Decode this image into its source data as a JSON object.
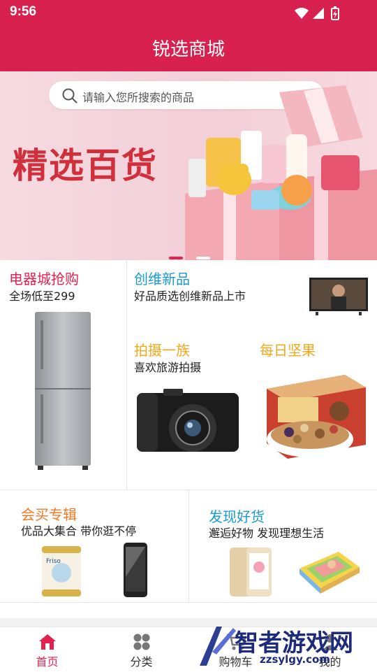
{
  "status": {
    "time": "9:56"
  },
  "header": {
    "title": "锐选商城"
  },
  "banner": {
    "search_placeholder": "请输入您所搜索的商品",
    "headline": "精选百货",
    "active_slide": 1,
    "slides_count": 2
  },
  "promos": [
    {
      "title": "电器城抢购",
      "subtitle": "全场低至299",
      "title_color": "#e5224f"
    },
    {
      "title": "创维新品",
      "subtitle": "好品质选创维新品上市",
      "title_color": "#1a9ad6"
    },
    {
      "title": "拍摄一族",
      "subtitle": "喜欢旅游拍摄",
      "title_color": "#f2a81b"
    },
    {
      "title": "每日坚果",
      "subtitle": "",
      "title_color": "#f2a81b"
    },
    {
      "title": "会买专辑",
      "subtitle": "优品大集合 带你逛不停",
      "title_color": "#f07a22"
    },
    {
      "title": "发现好货",
      "subtitle": "邂逅好物 发现理想生活",
      "title_color": "#1a9ad6"
    }
  ],
  "tabs": [
    {
      "label": "首页",
      "icon": "home-icon",
      "active": true
    },
    {
      "label": "分类",
      "icon": "grid-icon",
      "active": false
    },
    {
      "label": "购物车",
      "icon": "cart-icon",
      "active": false
    },
    {
      "label": "我的",
      "icon": "user-icon",
      "active": false
    }
  ],
  "watermark": {
    "brand": "智者游戏网",
    "site": "zzsylgy.com"
  },
  "colors": {
    "brand": "#d9214f",
    "tab_active": "#e5224f"
  }
}
